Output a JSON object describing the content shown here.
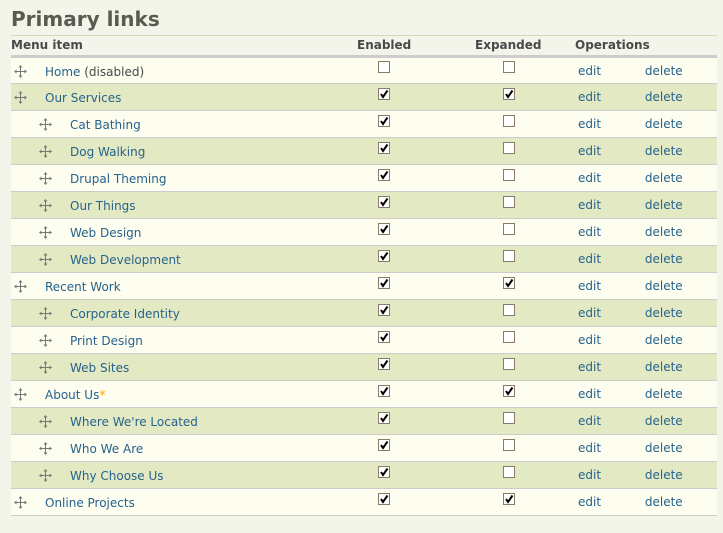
{
  "title": "Primary links",
  "headers": {
    "item": "Menu item",
    "enabled": "Enabled",
    "expanded": "Expanded",
    "operations": "Operations"
  },
  "ops": {
    "edit": "edit",
    "delete": "delete"
  },
  "rows": [
    {
      "label": "Home",
      "suffix": " (disabled)",
      "star": "",
      "depth": 0,
      "enabled": false,
      "expanded": false
    },
    {
      "label": "Our Services",
      "suffix": "",
      "star": "",
      "depth": 0,
      "enabled": true,
      "expanded": true
    },
    {
      "label": "Cat Bathing",
      "suffix": "",
      "star": "",
      "depth": 1,
      "enabled": true,
      "expanded": false
    },
    {
      "label": "Dog Walking",
      "suffix": "",
      "star": "",
      "depth": 1,
      "enabled": true,
      "expanded": false
    },
    {
      "label": "Drupal Theming",
      "suffix": "",
      "star": "",
      "depth": 1,
      "enabled": true,
      "expanded": false
    },
    {
      "label": "Our Things",
      "suffix": "",
      "star": "",
      "depth": 1,
      "enabled": true,
      "expanded": false
    },
    {
      "label": "Web Design",
      "suffix": "",
      "star": "",
      "depth": 1,
      "enabled": true,
      "expanded": false
    },
    {
      "label": "Web Development",
      "suffix": "",
      "star": "",
      "depth": 1,
      "enabled": true,
      "expanded": false
    },
    {
      "label": "Recent Work",
      "suffix": "",
      "star": "",
      "depth": 0,
      "enabled": true,
      "expanded": true
    },
    {
      "label": "Corporate Identity",
      "suffix": "",
      "star": "",
      "depth": 1,
      "enabled": true,
      "expanded": false
    },
    {
      "label": "Print Design",
      "suffix": "",
      "star": "",
      "depth": 1,
      "enabled": true,
      "expanded": false
    },
    {
      "label": "Web Sites",
      "suffix": "",
      "star": "",
      "depth": 1,
      "enabled": true,
      "expanded": false
    },
    {
      "label": "About Us",
      "suffix": "",
      "star": "*",
      "depth": 0,
      "enabled": true,
      "expanded": true
    },
    {
      "label": "Where We're Located",
      "suffix": "",
      "star": "",
      "depth": 1,
      "enabled": true,
      "expanded": false
    },
    {
      "label": "Who We Are",
      "suffix": "",
      "star": "",
      "depth": 1,
      "enabled": true,
      "expanded": false
    },
    {
      "label": "Why Choose Us",
      "suffix": "",
      "star": "",
      "depth": 1,
      "enabled": true,
      "expanded": false
    },
    {
      "label": "Online Projects",
      "suffix": "",
      "star": "",
      "depth": 0,
      "enabled": true,
      "expanded": true
    }
  ]
}
